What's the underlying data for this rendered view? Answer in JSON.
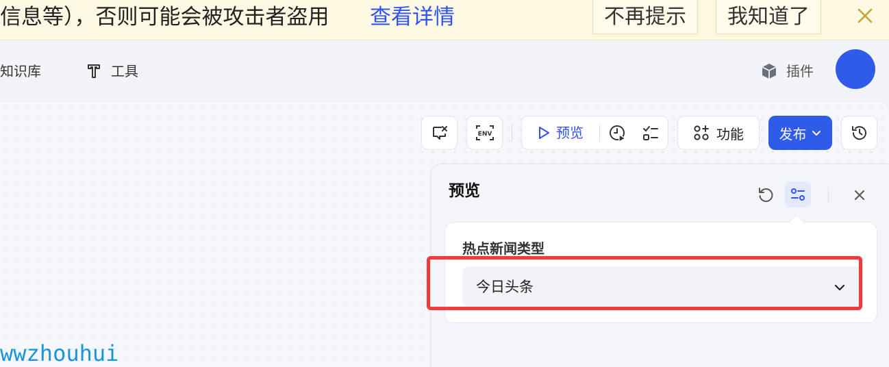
{
  "banner": {
    "message": "信息等），否则可能会被攻击者盗用",
    "link": "查看详情",
    "no_remind": "不再提示",
    "got_it": "我知道了",
    "close_icon": "close-icon",
    "link_color": "#2f54eb",
    "background": "#fdf8e1"
  },
  "header": {
    "nav_knowledge": "知识库",
    "nav_tools": "工具",
    "plugin": "插件",
    "avatar_color": "#2e5be8"
  },
  "toolbar": {
    "preview": "预览",
    "features": "功能",
    "publish": "发布",
    "publish_color": "#2e5be8"
  },
  "preview_panel": {
    "title": "预览",
    "field_label": "热点新闻类型",
    "select_value": "今日头条",
    "highlight_color": "#ef3b3b"
  },
  "watermark": "wwzhouhui"
}
